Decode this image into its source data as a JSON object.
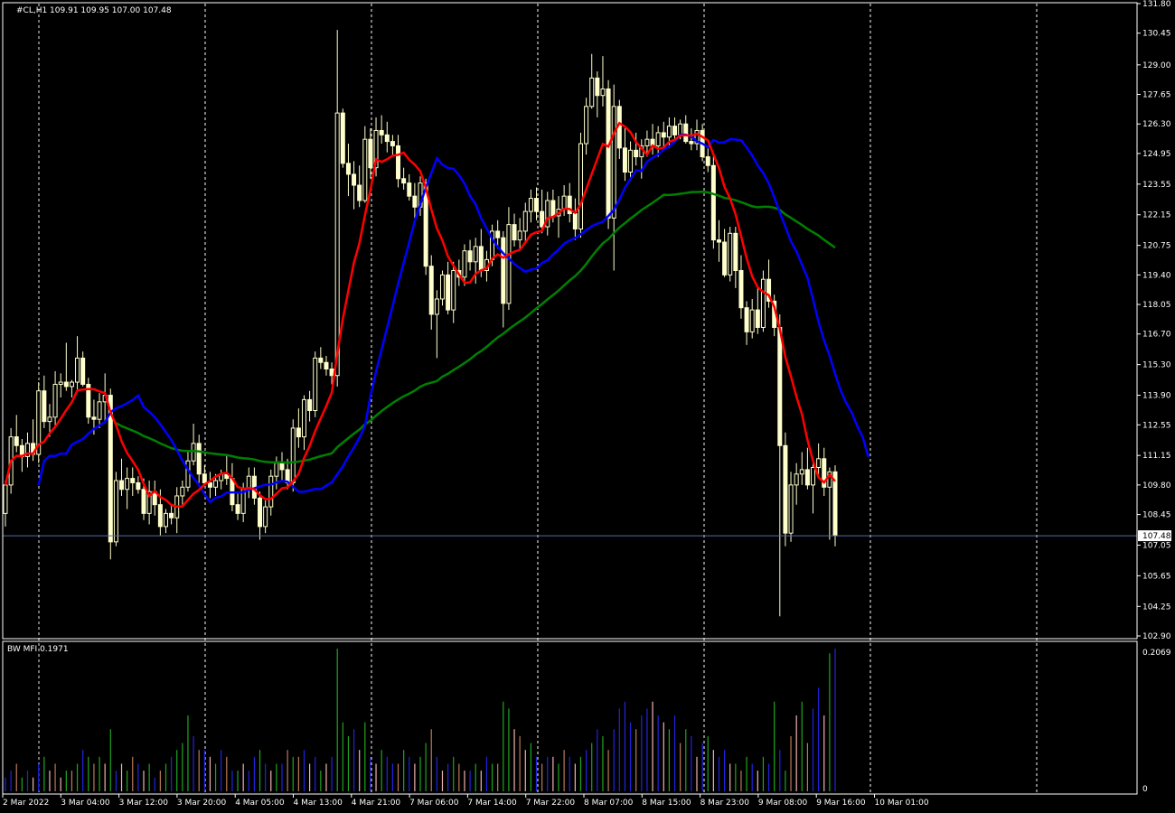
{
  "colors": {
    "background": "#000000",
    "frame": "#ffffff",
    "grid": "#ffffff",
    "candle_bull": "#000000",
    "candle_bear": "#ffffcc",
    "candle_outline": "#ffffcc",
    "ma_fast": "#ff0000",
    "ma_mid": "#0000ff",
    "ma_slow": "#008000",
    "bid_line": "#5a6aa0",
    "mfi_green": "#1fa51f",
    "mfi_brown": "#b97a57",
    "mfi_blue": "#2323e0",
    "mfi_pink": "#f1b2b2"
  },
  "header": {
    "symbol_info": "#CL,H1  109.91 109.95 107.00 107.48",
    "indicator_label": "BW MFI 0.1971"
  },
  "price_axis": {
    "ticks": [
      "131.80",
      "130.45",
      "129.00",
      "127.65",
      "126.30",
      "124.95",
      "123.55",
      "122.15",
      "120.75",
      "119.40",
      "118.05",
      "116.70",
      "115.30",
      "113.90",
      "112.55",
      "111.15",
      "109.80",
      "108.45",
      "107.05",
      "105.65",
      "104.25",
      "102.90"
    ],
    "current_price": "107.48"
  },
  "indicator_axis": {
    "max_label": "0.2069",
    "zero_label": "0"
  },
  "time_axis": {
    "labels": [
      "2 Mar 2022",
      "3 Mar 04:00",
      "3 Mar 12:00",
      "3 Mar 20:00",
      "4 Mar 05:00",
      "4 Mar 13:00",
      "4 Mar 21:00",
      "7 Mar 06:00",
      "7 Mar 14:00",
      "7 Mar 22:00",
      "8 Mar 07:00",
      "8 Mar 15:00",
      "8 Mar 23:00",
      "9 Mar 08:00",
      "9 Mar 16:00",
      "10 Mar 01:00"
    ]
  },
  "chart_data": {
    "type": "candlestick",
    "symbol": "#CL",
    "timeframe": "H1",
    "ylim": [
      102.9,
      131.8
    ],
    "mfi_ylim": [
      0,
      0.2069
    ],
    "candles": [
      [
        108.5,
        110.0,
        107.9,
        109.8
      ],
      [
        109.8,
        112.4,
        109.4,
        112.0
      ],
      [
        112.0,
        113.0,
        111.3,
        111.6
      ],
      [
        111.6,
        111.9,
        110.4,
        111.1
      ],
      [
        111.1,
        112.2,
        110.6,
        111.7
      ],
      [
        111.7,
        112.8,
        110.9,
        111.2
      ],
      [
        111.2,
        114.5,
        110.8,
        114.1
      ],
      [
        114.1,
        114.8,
        112.4,
        112.7
      ],
      [
        112.7,
        113.5,
        112.0,
        112.9
      ],
      [
        112.9,
        115.0,
        112.4,
        114.4
      ],
      [
        114.4,
        114.9,
        113.8,
        114.5
      ],
      [
        114.5,
        116.3,
        114.1,
        114.3
      ],
      [
        114.3,
        114.6,
        113.8,
        114.5
      ],
      [
        114.5,
        116.6,
        114.1,
        115.6
      ],
      [
        115.6,
        115.9,
        114.3,
        114.4
      ],
      [
        114.4,
        114.7,
        112.6,
        112.9
      ],
      [
        112.9,
        113.7,
        112.1,
        112.8
      ],
      [
        112.8,
        114.0,
        112.4,
        113.6
      ],
      [
        113.6,
        114.9,
        112.7,
        113.9
      ],
      [
        113.9,
        114.2,
        106.4,
        107.2
      ],
      [
        107.2,
        110.4,
        107.0,
        110.0
      ],
      [
        110.0,
        111.0,
        109.3,
        109.6
      ],
      [
        109.6,
        110.6,
        108.7,
        110.1
      ],
      [
        110.1,
        110.6,
        109.3,
        109.9
      ],
      [
        109.9,
        110.2,
        109.4,
        109.6
      ],
      [
        109.6,
        110.1,
        108.2,
        108.5
      ],
      [
        108.5,
        110.0,
        108.0,
        109.5
      ],
      [
        109.5,
        110.0,
        108.4,
        108.9
      ],
      [
        108.9,
        109.6,
        107.5,
        107.9
      ],
      [
        107.9,
        108.7,
        107.6,
        108.5
      ],
      [
        108.5,
        108.9,
        108.0,
        108.3
      ],
      [
        108.3,
        109.7,
        107.6,
        109.3
      ],
      [
        109.3,
        110.0,
        108.9,
        109.7
      ],
      [
        109.7,
        111.3,
        109.5,
        110.9
      ],
      [
        110.9,
        112.6,
        110.7,
        111.7
      ],
      [
        111.7,
        112.1,
        109.9,
        110.3
      ],
      [
        110.3,
        110.7,
        109.8,
        109.9
      ],
      [
        109.9,
        110.4,
        109.2,
        109.7
      ],
      [
        109.7,
        110.3,
        109.3,
        110.0
      ],
      [
        110.0,
        110.5,
        109.6,
        110.3
      ],
      [
        110.3,
        111.2,
        109.8,
        110.1
      ],
      [
        110.1,
        110.8,
        108.6,
        108.9
      ],
      [
        108.9,
        109.4,
        108.2,
        108.5
      ],
      [
        108.5,
        109.9,
        108.1,
        109.6
      ],
      [
        109.6,
        110.6,
        109.2,
        110.2
      ],
      [
        110.2,
        110.6,
        108.9,
        109.2
      ],
      [
        109.2,
        109.5,
        107.3,
        107.9
      ],
      [
        107.9,
        109.1,
        107.6,
        108.8
      ],
      [
        108.8,
        110.5,
        108.4,
        110.2
      ],
      [
        110.2,
        111.1,
        109.6,
        110.8
      ],
      [
        110.8,
        111.3,
        110.0,
        110.5
      ],
      [
        110.5,
        111.0,
        109.6,
        109.9
      ],
      [
        109.9,
        112.8,
        109.5,
        112.4
      ],
      [
        112.4,
        113.3,
        111.5,
        112.0
      ],
      [
        112.0,
        113.9,
        111.4,
        113.7
      ],
      [
        113.7,
        114.1,
        112.7,
        113.2
      ],
      [
        113.2,
        115.9,
        112.9,
        115.6
      ],
      [
        115.6,
        116.1,
        115.1,
        115.4
      ],
      [
        115.4,
        115.7,
        114.8,
        115.1
      ],
      [
        115.1,
        115.4,
        114.4,
        114.8
      ],
      [
        114.8,
        130.6,
        114.3,
        126.8
      ],
      [
        126.8,
        127.0,
        124.3,
        124.5
      ],
      [
        124.5,
        125.4,
        123.0,
        124.0
      ],
      [
        124.0,
        124.6,
        122.4,
        123.5
      ],
      [
        123.5,
        124.4,
        122.5,
        122.8
      ],
      [
        122.8,
        126.2,
        122.7,
        125.6
      ],
      [
        125.6,
        126.1,
        123.8,
        124.3
      ],
      [
        124.3,
        126.6,
        123.9,
        126.0
      ],
      [
        126.0,
        126.7,
        125.4,
        125.8
      ],
      [
        125.8,
        126.4,
        125.0,
        125.5
      ],
      [
        125.5,
        125.8,
        124.9,
        125.3
      ],
      [
        125.3,
        125.8,
        123.4,
        123.8
      ],
      [
        123.8,
        124.3,
        123.3,
        123.6
      ],
      [
        123.6,
        124.0,
        122.8,
        123.0
      ],
      [
        123.0,
        123.6,
        122.0,
        122.5
      ],
      [
        122.5,
        123.9,
        122.1,
        123.6
      ],
      [
        123.6,
        123.8,
        119.4,
        119.8
      ],
      [
        119.8,
        120.3,
        116.9,
        117.6
      ],
      [
        117.6,
        118.7,
        115.6,
        118.3
      ],
      [
        118.3,
        119.6,
        118.0,
        119.4
      ],
      [
        119.4,
        120.0,
        117.6,
        117.8
      ],
      [
        117.8,
        120.0,
        117.2,
        119.6
      ],
      [
        119.6,
        120.1,
        118.9,
        119.3
      ],
      [
        119.3,
        120.8,
        118.9,
        120.5
      ],
      [
        120.5,
        121.0,
        119.6,
        120.0
      ],
      [
        120.0,
        121.1,
        119.0,
        120.7
      ],
      [
        120.7,
        121.5,
        119.3,
        119.6
      ],
      [
        119.6,
        120.5,
        119.1,
        120.1
      ],
      [
        120.1,
        121.7,
        119.8,
        121.4
      ],
      [
        121.4,
        121.9,
        120.6,
        121.1
      ],
      [
        121.1,
        121.4,
        117.0,
        118.1
      ],
      [
        118.1,
        122.5,
        117.8,
        121.7
      ],
      [
        121.7,
        122.2,
        120.7,
        121.0
      ],
      [
        121.0,
        122.0,
        120.6,
        121.4
      ],
      [
        121.4,
        122.7,
        120.9,
        122.3
      ],
      [
        122.3,
        123.3,
        121.8,
        122.9
      ],
      [
        122.9,
        123.4,
        121.9,
        122.3
      ],
      [
        122.3,
        123.3,
        121.3,
        121.6
      ],
      [
        121.6,
        123.2,
        121.2,
        122.8
      ],
      [
        122.8,
        123.3,
        121.8,
        122.1
      ],
      [
        122.1,
        123.0,
        121.1,
        122.4
      ],
      [
        122.4,
        123.5,
        122.1,
        123.0
      ],
      [
        123.0,
        123.6,
        121.8,
        122.2
      ],
      [
        122.2,
        122.9,
        121.0,
        121.5
      ],
      [
        121.5,
        125.9,
        121.1,
        125.4
      ],
      [
        125.4,
        127.5,
        124.9,
        127.1
      ],
      [
        127.1,
        129.5,
        127.0,
        128.4
      ],
      [
        128.4,
        128.7,
        126.6,
        127.6
      ],
      [
        127.6,
        129.4,
        127.1,
        127.9
      ],
      [
        127.9,
        128.3,
        121.5,
        122.0
      ],
      [
        122.0,
        128.1,
        119.6,
        127.1
      ],
      [
        127.1,
        127.4,
        124.7,
        125.2
      ],
      [
        125.2,
        126.1,
        123.7,
        124.1
      ],
      [
        124.1,
        125.5,
        123.7,
        125.1
      ],
      [
        125.1,
        125.9,
        124.4,
        124.8
      ],
      [
        124.8,
        125.6,
        123.8,
        125.3
      ],
      [
        125.3,
        126.0,
        124.8,
        125.6
      ],
      [
        125.6,
        126.3,
        124.9,
        125.3
      ],
      [
        125.3,
        126.2,
        124.8,
        125.9
      ],
      [
        125.9,
        126.4,
        125.2,
        125.7
      ],
      [
        125.7,
        126.6,
        125.2,
        126.2
      ],
      [
        126.2,
        126.6,
        125.6,
        125.8
      ],
      [
        125.8,
        126.5,
        125.6,
        126.3
      ],
      [
        126.3,
        126.7,
        125.4,
        125.5
      ],
      [
        125.5,
        126.1,
        125.1,
        125.4
      ],
      [
        125.4,
        126.5,
        125.1,
        126.0
      ],
      [
        126.0,
        126.3,
        124.6,
        124.8
      ],
      [
        124.8,
        125.2,
        124.1,
        124.4
      ],
      [
        124.4,
        124.9,
        120.6,
        121.0
      ],
      [
        121.0,
        121.9,
        120.0,
        120.9
      ],
      [
        120.9,
        121.5,
        119.3,
        119.4
      ],
      [
        119.4,
        121.6,
        119.1,
        121.3
      ],
      [
        121.3,
        121.6,
        118.8,
        119.6
      ],
      [
        119.6,
        120.3,
        117.4,
        117.9
      ],
      [
        117.9,
        118.2,
        116.2,
        116.8
      ],
      [
        116.8,
        118.3,
        116.5,
        117.8
      ],
      [
        117.8,
        118.8,
        116.7,
        117.0
      ],
      [
        117.0,
        119.6,
        116.8,
        119.2
      ],
      [
        119.2,
        120.1,
        117.9,
        118.2
      ],
      [
        118.2,
        118.5,
        116.6,
        117.0
      ],
      [
        117.0,
        117.6,
        103.8,
        111.6
      ],
      [
        111.6,
        112.2,
        107.0,
        107.6
      ],
      [
        107.6,
        110.4,
        107.2,
        109.8
      ],
      [
        109.8,
        110.8,
        108.9,
        110.3
      ],
      [
        110.3,
        111.3,
        109.8,
        110.5
      ],
      [
        110.5,
        111.5,
        109.6,
        109.8
      ],
      [
        109.8,
        110.9,
        108.5,
        110.6
      ],
      [
        110.6,
        111.7,
        110.2,
        111.0
      ],
      [
        111.0,
        111.5,
        109.3,
        109.7
      ],
      [
        109.7,
        110.6,
        107.3,
        110.4
      ],
      [
        110.4,
        110.7,
        107.0,
        107.48
      ]
    ],
    "mfi": [
      0.02,
      0.03,
      0.04,
      0.02,
      0.03,
      0.02,
      0.04,
      0.05,
      0.03,
      0.04,
      0.02,
      0.03,
      0.03,
      0.04,
      0.06,
      0.05,
      0.04,
      0.05,
      0.04,
      0.09,
      0.03,
      0.04,
      0.03,
      0.05,
      0.04,
      0.03,
      0.04,
      0.02,
      0.03,
      0.04,
      0.05,
      0.06,
      0.07,
      0.11,
      0.08,
      0.06,
      0.06,
      0.05,
      0.04,
      0.06,
      0.05,
      0.03,
      0.03,
      0.04,
      0.03,
      0.05,
      0.06,
      0.04,
      0.03,
      0.04,
      0.04,
      0.06,
      0.05,
      0.05,
      0.06,
      0.04,
      0.05,
      0.03,
      0.04,
      0.05,
      0.2069,
      0.1,
      0.08,
      0.09,
      0.06,
      0.1,
      0.05,
      0.04,
      0.06,
      0.05,
      0.04,
      0.04,
      0.06,
      0.05,
      0.04,
      0.05,
      0.07,
      0.09,
      0.05,
      0.03,
      0.04,
      0.05,
      0.04,
      0.03,
      0.03,
      0.04,
      0.03,
      0.05,
      0.04,
      0.04,
      0.13,
      0.12,
      0.09,
      0.08,
      0.06,
      0.07,
      0.05,
      0.04,
      0.05,
      0.05,
      0.04,
      0.06,
      0.05,
      0.04,
      0.05,
      0.06,
      0.07,
      0.09,
      0.08,
      0.06,
      0.09,
      0.12,
      0.13,
      0.1,
      0.09,
      0.11,
      0.12,
      0.13,
      0.11,
      0.1,
      0.09,
      0.11,
      0.07,
      0.09,
      0.08,
      0.05,
      0.07,
      0.08,
      0.06,
      0.05,
      0.06,
      0.04,
      0.04,
      0.03,
      0.05,
      0.04,
      0.03,
      0.05,
      0.04,
      0.13,
      0.06,
      0.03,
      0.08,
      0.11,
      0.13,
      0.07,
      0.12,
      0.15,
      0.11,
      0.2,
      0.2069
    ],
    "mfi_colors": [
      "blue",
      "blue",
      "brown",
      "green",
      "blue",
      "pink",
      "blue",
      "green",
      "pink",
      "brown",
      "pink",
      "green",
      "brown",
      "green",
      "blue",
      "green",
      "brown",
      "green",
      "pink",
      "green",
      "blue",
      "pink",
      "green",
      "brown",
      "blue",
      "pink",
      "green",
      "blue",
      "brown",
      "green",
      "blue",
      "green",
      "green",
      "green",
      "blue",
      "brown",
      "blue",
      "pink",
      "green",
      "blue",
      "brown",
      "blue",
      "green",
      "pink",
      "blue",
      "blue",
      "green",
      "blue",
      "pink",
      "green",
      "blue",
      "brown",
      "green",
      "brown",
      "blue",
      "pink",
      "blue",
      "green",
      "pink",
      "blue",
      "green",
      "green",
      "green",
      "blue",
      "pink",
      "green",
      "blue",
      "pink",
      "green",
      "blue",
      "blue",
      "brown",
      "green",
      "blue",
      "pink",
      "green",
      "green",
      "brown",
      "blue",
      "pink",
      "blue",
      "green",
      "brown",
      "pink",
      "blue",
      "green",
      "pink",
      "blue",
      "green",
      "brown",
      "green",
      "green",
      "pink",
      "brown",
      "pink",
      "green",
      "blue",
      "brown",
      "blue",
      "pink",
      "green",
      "brown",
      "blue",
      "pink",
      "green",
      "blue",
      "green",
      "blue",
      "green",
      "brown",
      "blue",
      "blue",
      "blue",
      "blue",
      "brown",
      "blue",
      "blue",
      "pink",
      "blue",
      "pink",
      "green",
      "blue",
      "brown",
      "green",
      "blue",
      "pink",
      "blue",
      "green",
      "pink",
      "blue",
      "blue",
      "pink",
      "green",
      "brown",
      "green",
      "blue",
      "pink",
      "green",
      "blue",
      "green",
      "blue",
      "green",
      "brown",
      "pink",
      "green",
      "brown",
      "blue",
      "blue",
      "pink",
      "green"
    ]
  }
}
